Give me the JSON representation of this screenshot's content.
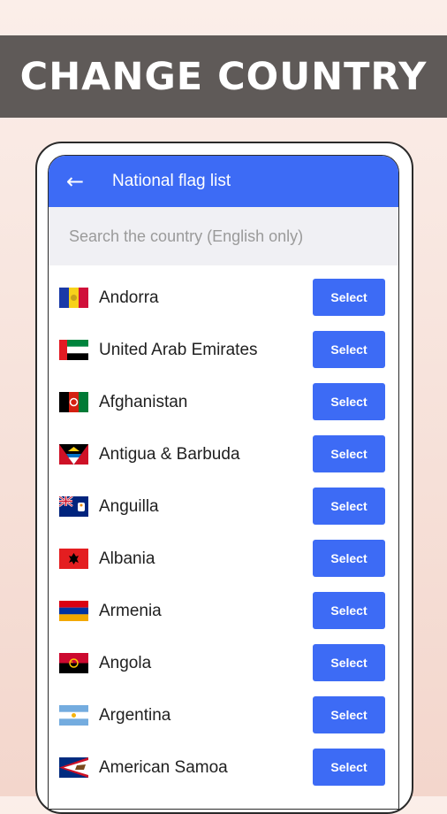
{
  "banner": {
    "title": "CHANGE COUNTRY"
  },
  "appbar": {
    "back_icon": "arrow-left-icon",
    "title": "National flag list"
  },
  "search": {
    "placeholder": "Search the country (English only)",
    "value": ""
  },
  "countries": [
    {
      "name": "Andorra",
      "button": "Select",
      "flag": "andorra-flag"
    },
    {
      "name": "United Arab Emirates",
      "button": "Select",
      "flag": "uae-flag"
    },
    {
      "name": "Afghanistan",
      "button": "Select",
      "flag": "afghanistan-flag"
    },
    {
      "name": "Antigua & Barbuda",
      "button": "Select",
      "flag": "antigua-flag"
    },
    {
      "name": "Anguilla",
      "button": "Select",
      "flag": "anguilla-flag"
    },
    {
      "name": "Albania",
      "button": "Select",
      "flag": "albania-flag"
    },
    {
      "name": "Armenia",
      "button": "Select",
      "flag": "armenia-flag"
    },
    {
      "name": "Angola",
      "button": "Select",
      "flag": "angola-flag"
    },
    {
      "name": "Argentina",
      "button": "Select",
      "flag": "argentina-flag"
    },
    {
      "name": "American Samoa",
      "button": "Select",
      "flag": "american-samoa-flag"
    }
  ],
  "colors": {
    "accent": "#3d6bf5",
    "banner": "#5f5a58",
    "background": "#f6e0d8"
  }
}
